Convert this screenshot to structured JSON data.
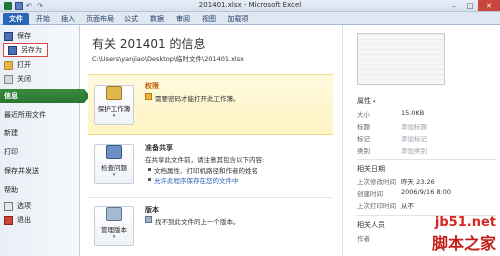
{
  "window": {
    "title": "201401.xlsx - Microsoft Excel"
  },
  "ribbon": {
    "tabs": [
      "文件",
      "开始",
      "插入",
      "页面布局",
      "公式",
      "数据",
      "审阅",
      "视图",
      "加载项"
    ]
  },
  "sidebar": {
    "items": [
      {
        "label": "保存",
        "icon": "floppy-icon"
      },
      {
        "label": "另存为",
        "icon": "save-as-icon"
      },
      {
        "label": "打开",
        "icon": "folder-icon"
      },
      {
        "label": "关闭",
        "icon": "close-file-icon"
      },
      {
        "label": "信息"
      },
      {
        "label": "最近所用文件"
      },
      {
        "label": "新建"
      },
      {
        "label": "打印"
      },
      {
        "label": "保存并发送"
      },
      {
        "label": "帮助"
      },
      {
        "label": "选项",
        "icon": "options-icon"
      },
      {
        "label": "退出",
        "icon": "exit-icon"
      }
    ]
  },
  "main": {
    "title": "有关 201401 的信息",
    "path": "C:\\Users\\yanjiao\\Desktop\\临时文件\\201401.xlsx",
    "permissions": {
      "button": "保护工作簿",
      "heading": "权限",
      "text": "需要密码才能打开此工作簿。"
    },
    "sharing": {
      "button": "检查问题",
      "heading": "准备共享",
      "line1": "在共享此文件前，请注意其包含以下内容:",
      "line2": "文档属性、打印机路径和作者的姓名",
      "link": "允许此程序保存在您的文件中"
    },
    "versions": {
      "button": "管理版本",
      "heading": "版本",
      "text": "找不到此文件的上一个版本。"
    }
  },
  "properties": {
    "heading": "属性",
    "rows": [
      {
        "key": "大小",
        "value": "15.0KB",
        "hint": false
      },
      {
        "key": "标题",
        "value": "添加标题",
        "hint": true
      },
      {
        "key": "标记",
        "value": "添加标记",
        "hint": true
      },
      {
        "key": "类别",
        "value": "添加类别",
        "hint": true
      }
    ],
    "dates_heading": "相关日期",
    "dates": [
      {
        "key": "上次修改时间",
        "value": "昨天 23:26"
      },
      {
        "key": "创建时间",
        "value": "2006/9/16 8:00"
      },
      {
        "key": "上次打印时间",
        "value": "从不"
      }
    ],
    "people_heading": "相关人员",
    "people_first_key": "作者"
  },
  "watermark": {
    "url": "jb51.net",
    "name": "脚本之家"
  }
}
